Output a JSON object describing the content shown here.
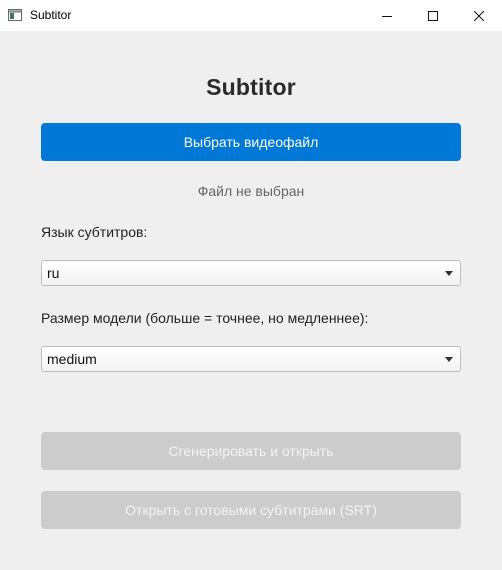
{
  "window": {
    "title": "Subtitor",
    "icons": {
      "app": "app-window-icon",
      "minimize": "minimize-icon",
      "maximize": "maximize-icon",
      "close": "close-icon"
    }
  },
  "main": {
    "app_title": "Subtitor",
    "pick_file_label": "Выбрать видеофайл",
    "file_status": "Файл не выбран",
    "language_label": "Язык субтитров:",
    "language_value": "ru",
    "model_label": "Размер модели (больше = точнее, но медленнее):",
    "model_value": "medium",
    "generate_label": "Сгенерировать и открыть",
    "open_srt_label": "Открыть с готовыми субтитрами (SRT)"
  },
  "colors": {
    "accent": "#0078d7",
    "disabled": "#cccccc",
    "background": "#efefef"
  }
}
